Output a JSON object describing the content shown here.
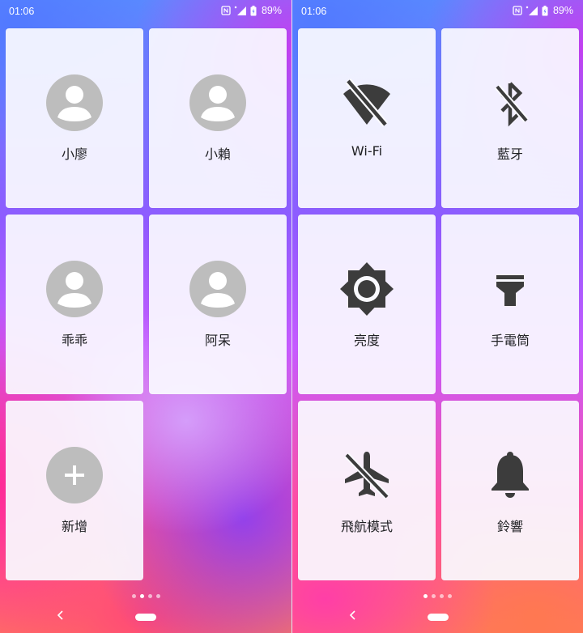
{
  "status_bar": {
    "time": "01:06",
    "battery": "89%"
  },
  "left_page": {
    "contacts": [
      {
        "name": "小廖"
      },
      {
        "name": "小賴"
      },
      {
        "name": "乖乖"
      },
      {
        "name": "阿呆"
      }
    ],
    "add_label": "新增"
  },
  "right_page": {
    "toggles": [
      {
        "label": "Wi-Fi",
        "icon": "wifi-off-icon"
      },
      {
        "label": "藍牙",
        "icon": "bluetooth-off-icon"
      },
      {
        "label": "亮度",
        "icon": "brightness-icon"
      },
      {
        "label": "手電筒",
        "icon": "flashlight-icon"
      },
      {
        "label": "飛航模式",
        "icon": "airplane-mode-off-icon"
      },
      {
        "label": "鈴響",
        "icon": "bell-icon"
      }
    ]
  },
  "colors": {
    "icon_dark": "#3c3c3c",
    "avatar_grey": "#bdbdbd",
    "tile_bg": "#fafaff"
  }
}
